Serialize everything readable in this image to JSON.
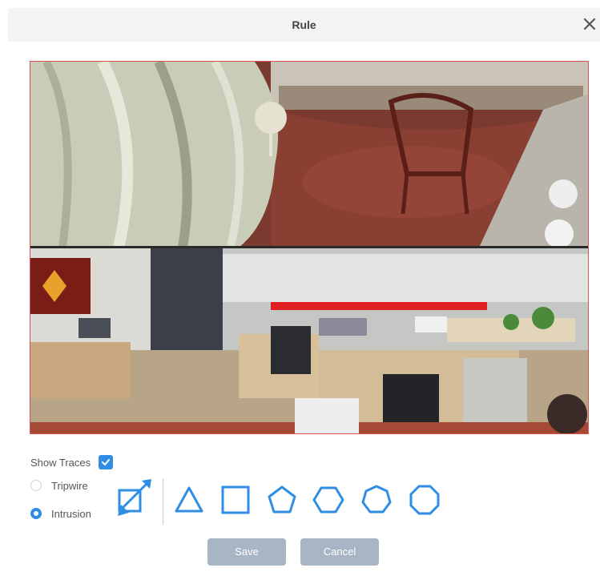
{
  "dialog": {
    "title": "Rule",
    "close_icon": "close-icon"
  },
  "video": {
    "description_icon": "camera-feed",
    "region_color": "#d9534f"
  },
  "controls": {
    "show_traces_label": "Show Traces",
    "show_traces_checked": true,
    "rule_types": [
      {
        "label": "Tripwire",
        "selected": false
      },
      {
        "label": "Intrusion",
        "selected": true
      }
    ],
    "shape_tools": [
      "auto-area-icon",
      "triangle-icon",
      "square-icon",
      "pentagon-icon",
      "hexagon-icon",
      "heptagon-icon",
      "octagon-icon"
    ],
    "accent_color": "#2f8de4"
  },
  "buttons": {
    "save_label": "Save",
    "cancel_label": "Cancel",
    "button_color": "#a8b5c5"
  }
}
